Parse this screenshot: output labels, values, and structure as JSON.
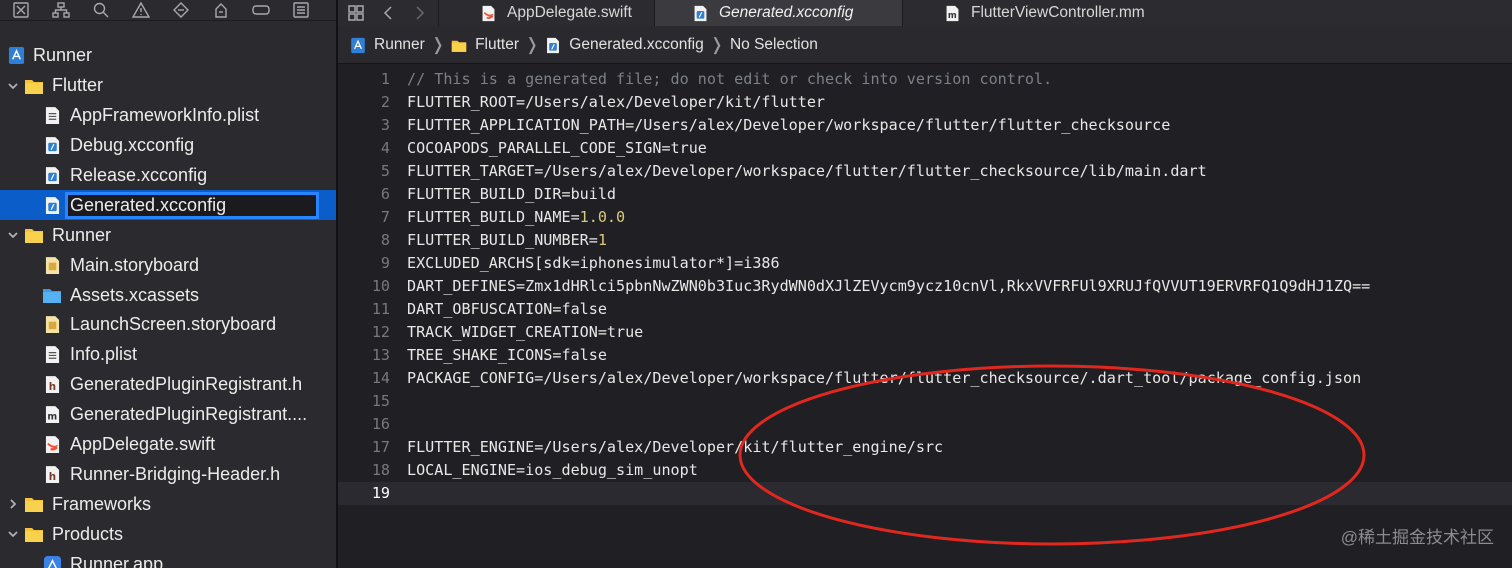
{
  "sidebar": {
    "toolbar_icons": [
      "close-box-icon",
      "hierarchy-icon",
      "search-icon",
      "warning-icon",
      "diamond-icon",
      "spray-icon",
      "label-icon",
      "list-icon"
    ],
    "tree": [
      {
        "label": "Runner",
        "icon": "project-icon",
        "expanded": null
      },
      {
        "label": "Flutter",
        "icon": "folder-icon",
        "expanded": true
      },
      {
        "label": "AppFrameworkInfo.plist",
        "icon": "plist-icon"
      },
      {
        "label": "Debug.xcconfig",
        "icon": "xcconfig-icon"
      },
      {
        "label": "Release.xcconfig",
        "icon": "xcconfig-icon"
      },
      {
        "label": "Generated.xcconfig",
        "icon": "xcconfig-icon",
        "selected": true
      },
      {
        "label": "Runner",
        "icon": "folder-icon",
        "expanded": true
      },
      {
        "label": "Main.storyboard",
        "icon": "storyboard-icon"
      },
      {
        "label": "Assets.xcassets",
        "icon": "assets-folder-icon"
      },
      {
        "label": "LaunchScreen.storyboard",
        "icon": "storyboard-icon"
      },
      {
        "label": "Info.plist",
        "icon": "plist-icon"
      },
      {
        "label": "GeneratedPluginRegistrant.h",
        "icon": "header-icon"
      },
      {
        "label": "GeneratedPluginRegistrant....",
        "icon": "objc-icon"
      },
      {
        "label": "AppDelegate.swift",
        "icon": "swift-icon"
      },
      {
        "label": "Runner-Bridging-Header.h",
        "icon": "header-icon"
      },
      {
        "label": "Frameworks",
        "icon": "folder-icon",
        "expanded": false
      },
      {
        "label": "Products",
        "icon": "folder-icon",
        "expanded": true
      },
      {
        "label": "Runner.app",
        "icon": "app-icon"
      }
    ]
  },
  "tabs": [
    {
      "label": "AppDelegate.swift",
      "icon": "swift-icon",
      "active": false
    },
    {
      "label": "Generated.xcconfig",
      "icon": "xcconfig-icon",
      "active": true
    },
    {
      "label": "FlutterViewController.mm",
      "icon": "objc-icon",
      "active": false
    }
  ],
  "breadcrumb": [
    {
      "label": "Runner",
      "icon": "project-icon"
    },
    {
      "label": "Flutter",
      "icon": "folder-icon"
    },
    {
      "label": "Generated.xcconfig",
      "icon": "xcconfig-icon"
    },
    {
      "label": "No Selection",
      "icon": ""
    }
  ],
  "code": [
    {
      "n": "1",
      "text": "// This is a generated file; do not edit or check into version control.",
      "comment": true
    },
    {
      "n": "2",
      "text": "FLUTTER_ROOT=/Users/alex/Developer/kit/flutter"
    },
    {
      "n": "3",
      "text": "FLUTTER_APPLICATION_PATH=/Users/alex/Developer/workspace/flutter/flutter_checksource"
    },
    {
      "n": "4",
      "text": "COCOAPODS_PARALLEL_CODE_SIGN=true"
    },
    {
      "n": "5",
      "text": "FLUTTER_TARGET=/Users/alex/Developer/workspace/flutter/flutter_checksource/lib/main.dart"
    },
    {
      "n": "6",
      "text": "FLUTTER_BUILD_DIR=build"
    },
    {
      "n": "7",
      "key": "FLUTTER_BUILD_NAME=",
      "num": "1.0.0"
    },
    {
      "n": "8",
      "key": "FLUTTER_BUILD_NUMBER=",
      "num": "1"
    },
    {
      "n": "9",
      "text": "EXCLUDED_ARCHS[sdk=iphonesimulator*]=i386"
    },
    {
      "n": "10",
      "text": "DART_DEFINES=Zmx1dHRlci5pbnNwZWN0b3Iuc3RydWN0dXJlZEVycm9ycz10cnVl,RkxVVFRFUl9XRUJfQVVUT19ERVRFQ1Q9dHJ1ZQ=="
    },
    {
      "n": "11",
      "text": "DART_OBFUSCATION=false"
    },
    {
      "n": "12",
      "text": "TRACK_WIDGET_CREATION=true"
    },
    {
      "n": "13",
      "text": "TREE_SHAKE_ICONS=false"
    },
    {
      "n": "14",
      "text": "PACKAGE_CONFIG=/Users/alex/Developer/workspace/flutter/flutter_checksource/.dart_tool/package_config.json"
    },
    {
      "n": "15",
      "text": ""
    },
    {
      "n": "16",
      "text": ""
    },
    {
      "n": "17",
      "text": "FLUTTER_ENGINE=/Users/alex/Developer/kit/flutter_engine/src"
    },
    {
      "n": "18",
      "text": "LOCAL_ENGINE=ios_debug_sim_unopt"
    },
    {
      "n": "19",
      "text": "",
      "current": true
    }
  ],
  "watermark": "@稀土掘金技术社区",
  "colors": {
    "accent": "#0b5ec9",
    "annotation": "#e0281e",
    "number_literal": "#d9c97c",
    "comment": "#7d8088"
  }
}
